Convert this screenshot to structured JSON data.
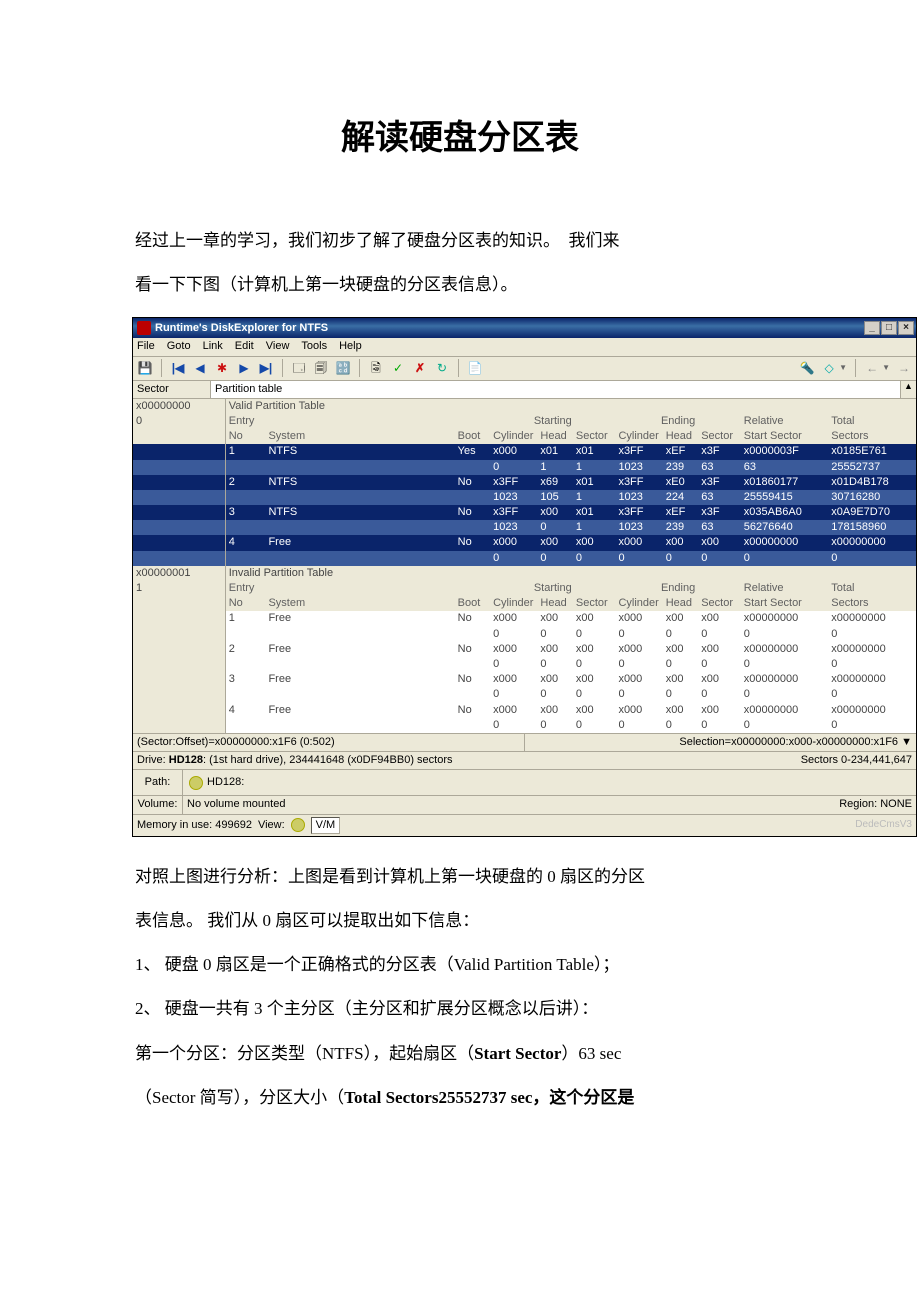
{
  "title": "解读硬盘分区表",
  "intro1": "经过上一章的学习，我们初步了解了硬盘分区表的知识。　我们来",
  "intro2": "看一下下图（计算机上第一块硬盘的分区表信息）。",
  "analysis1": "对照上图进行分析：上图是看到计算机上第一块硬盘的 0 扇区的分区",
  "analysis2": "表信息。 我们从 0 扇区可以提取出如下信息：",
  "li1": "1、 硬盘 0 扇区是一个正确格式的分区表（Valid Partition Table）；",
  "li2": "2、 硬盘一共有 3 个主分区（主分区和扩展分区概念以后讲）：",
  "p1a": "第一个分区：分区类型（NTFS），起始扇区（",
  "p1b": "Start Sector",
  "p1c": "）63 sec",
  "p2a": "（Sector 简写），分区大小（",
  "p2b": "Total Sectors25552737 sec，这个分区是",
  "app": {
    "title": "Runtime's DiskExplorer for NTFS",
    "menus": [
      "File",
      "Goto",
      "Link",
      "Edit",
      "View",
      "Tools",
      "Help"
    ],
    "sector_label": "Sector",
    "sector_val": "Partition table",
    "hdr_addr0": "x00000000",
    "hdr_idx0": "0",
    "valid_label": "Valid Partition Table",
    "hdr_addr1": "x00000001",
    "hdr_idx1": "1",
    "invalid_label": "Invalid Partition Table",
    "group": {
      "starting": "Starting",
      "ending": "Ending",
      "relative": "Relative",
      "total": "Total"
    },
    "cols": {
      "entry": "Entry",
      "no": "No",
      "system": "System",
      "boot": "Boot",
      "cyl": "Cylinder",
      "head": "Head",
      "sector": "Sector",
      "startsec": "Start Sector",
      "sectors": "Sectors"
    },
    "valid_rows": [
      {
        "no": "1",
        "system": "NTFS",
        "boot": "Yes",
        "sc": "x000",
        "sh": "x01",
        "ss": "x01",
        "ec": "x3FF",
        "eh": "xEF",
        "es": "x3F",
        "start": "x0000003F",
        "total": "x0185E761",
        "sc2": "0",
        "sh2": "1",
        "ss2": "1",
        "ec2": "1023",
        "eh2": "239",
        "es2": "63",
        "start2": "63",
        "total2": "25552737"
      },
      {
        "no": "2",
        "system": "NTFS",
        "boot": "No",
        "sc": "x3FF",
        "sh": "x69",
        "ss": "x01",
        "ec": "x3FF",
        "eh": "xE0",
        "es": "x3F",
        "start": "x01860177",
        "total": "x01D4B178",
        "sc2": "1023",
        "sh2": "105",
        "ss2": "1",
        "ec2": "1023",
        "eh2": "224",
        "es2": "63",
        "start2": "25559415",
        "total2": "30716280"
      },
      {
        "no": "3",
        "system": "NTFS",
        "boot": "No",
        "sc": "x3FF",
        "sh": "x00",
        "ss": "x01",
        "ec": "x3FF",
        "eh": "xEF",
        "es": "x3F",
        "start": "x035AB6A0",
        "total": "x0A9E7D70",
        "sc2": "1023",
        "sh2": "0",
        "ss2": "1",
        "ec2": "1023",
        "eh2": "239",
        "es2": "63",
        "start2": "56276640",
        "total2": "178158960"
      },
      {
        "no": "4",
        "system": "Free",
        "boot": "No",
        "sc": "x000",
        "sh": "x00",
        "ss": "x00",
        "ec": "x000",
        "eh": "x00",
        "es": "x00",
        "start": "x00000000",
        "total": "x00000000",
        "sc2": "0",
        "sh2": "0",
        "ss2": "0",
        "ec2": "0",
        "eh2": "0",
        "es2": "0",
        "start2": "0",
        "total2": "0"
      }
    ],
    "invalid_rows": [
      {
        "no": "1",
        "system": "Free",
        "boot": "No",
        "sc": "x000",
        "sh": "x00",
        "ss": "x00",
        "ec": "x000",
        "eh": "x00",
        "es": "x00",
        "start": "x00000000",
        "total": "x00000000",
        "sc2": "0",
        "sh2": "0",
        "ss2": "0",
        "ec2": "0",
        "eh2": "0",
        "es2": "0",
        "start2": "0",
        "total2": "0"
      },
      {
        "no": "2",
        "system": "Free",
        "boot": "No",
        "sc": "x000",
        "sh": "x00",
        "ss": "x00",
        "ec": "x000",
        "eh": "x00",
        "es": "x00",
        "start": "x00000000",
        "total": "x00000000",
        "sc2": "0",
        "sh2": "0",
        "ss2": "0",
        "ec2": "0",
        "eh2": "0",
        "es2": "0",
        "start2": "0",
        "total2": "0"
      },
      {
        "no": "3",
        "system": "Free",
        "boot": "No",
        "sc": "x000",
        "sh": "x00",
        "ss": "x00",
        "ec": "x000",
        "eh": "x00",
        "es": "x00",
        "start": "x00000000",
        "total": "x00000000",
        "sc2": "0",
        "sh2": "0",
        "ss2": "0",
        "ec2": "0",
        "eh2": "0",
        "es2": "0",
        "start2": "0",
        "total2": "0"
      },
      {
        "no": "4",
        "system": "Free",
        "boot": "No",
        "sc": "x000",
        "sh": "x00",
        "ss": "x00",
        "ec": "x000",
        "eh": "x00",
        "es": "x00",
        "start": "x00000000",
        "total": "x00000000",
        "sc2": "0",
        "sh2": "0",
        "ss2": "0",
        "ec2": "0",
        "eh2": "0",
        "es2": "0",
        "start2": "0",
        "total2": "0"
      }
    ],
    "status_left": "(Sector:Offset)=x00000000:x1F6 (0:502)",
    "status_right": "Selection=x00000000:x000-x00000000:x1F6",
    "drive_left_a": "Drive: ",
    "drive_left_b": "HD128",
    "drive_left_c": ": (1st hard drive), 234441648 (x0DF94BB0) sectors",
    "drive_right": "Sectors 0-234,441,647",
    "path_label": "Path:",
    "path_val": "HD128:",
    "vol_label": "Volume:",
    "vol_val": "No volume mounted",
    "vol_right": "Region: NONE",
    "mem": "Memory in use: 499692",
    "view_label": "View:",
    "view_val": "V/M",
    "watermark": "DedeCmsV3"
  }
}
